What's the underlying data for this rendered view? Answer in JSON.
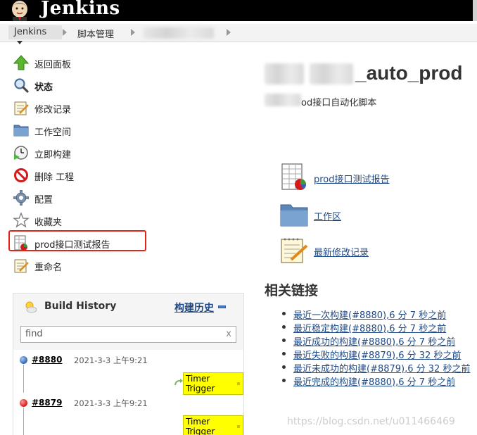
{
  "header": {
    "brand": "Jenkins"
  },
  "breadcrumb": {
    "root": "Jenkins",
    "folder": "脚本管理"
  },
  "sidebar": {
    "tasks": [
      {
        "label": "返回面板",
        "icon": "up-arrow-icon"
      },
      {
        "label": "状态",
        "icon": "search-icon"
      },
      {
        "label": "修改记录",
        "icon": "notepad-icon"
      },
      {
        "label": "工作空间",
        "icon": "folder-icon"
      },
      {
        "label": "立即构建",
        "icon": "clock-icon"
      },
      {
        "label": "删除 工程",
        "icon": "no-entry-icon"
      },
      {
        "label": "配置",
        "icon": "gear-icon"
      },
      {
        "label": "收藏夹",
        "icon": "star-icon"
      },
      {
        "label": "prod接口测试报告",
        "icon": "report-icon"
      },
      {
        "label": "重命名",
        "icon": "notepad-icon"
      }
    ]
  },
  "build_history": {
    "title": "Build History",
    "trend_link": "构建历史",
    "search_value": "find",
    "clear": "x",
    "builds": [
      {
        "number": "#8880",
        "date": "2021-3-3 上午9:21",
        "trigger": "Timer Trigger",
        "status": "blue"
      },
      {
        "number": "#8879",
        "date": "2021-3-3 上午9:21",
        "trigger": "Timer Trigger",
        "status": "red"
      }
    ]
  },
  "main": {
    "project_title": "_auto_prod",
    "description": "od接口自动化脚本",
    "links": [
      {
        "label": "prod接口测试报告",
        "icon": "report-icon"
      },
      {
        "label": "工作区",
        "icon": "folder-icon"
      },
      {
        "label": "最新修改记录",
        "icon": "notepad-icon"
      }
    ],
    "related_title": "相关链接",
    "permalinks": [
      "最近一次构建(#8880),6 分 7 秒之前",
      "最近稳定构建(#8880),6 分 7 秒之前",
      "最近成功的构建(#8880),6 分 7 秒之前",
      "最近失败的构建(#8879),6 分 32 秒之前",
      "最近未成功的构建(#8879),6 分 32 秒之前",
      "最近完成的构建(#8880),6 分 7 秒之前"
    ]
  },
  "watermark": "https://blog.csdn.net/u011466469",
  "colors": {
    "accent_link": "#204a87",
    "highlight_border": "#e2231a",
    "trigger_bg": "#ffff00"
  }
}
